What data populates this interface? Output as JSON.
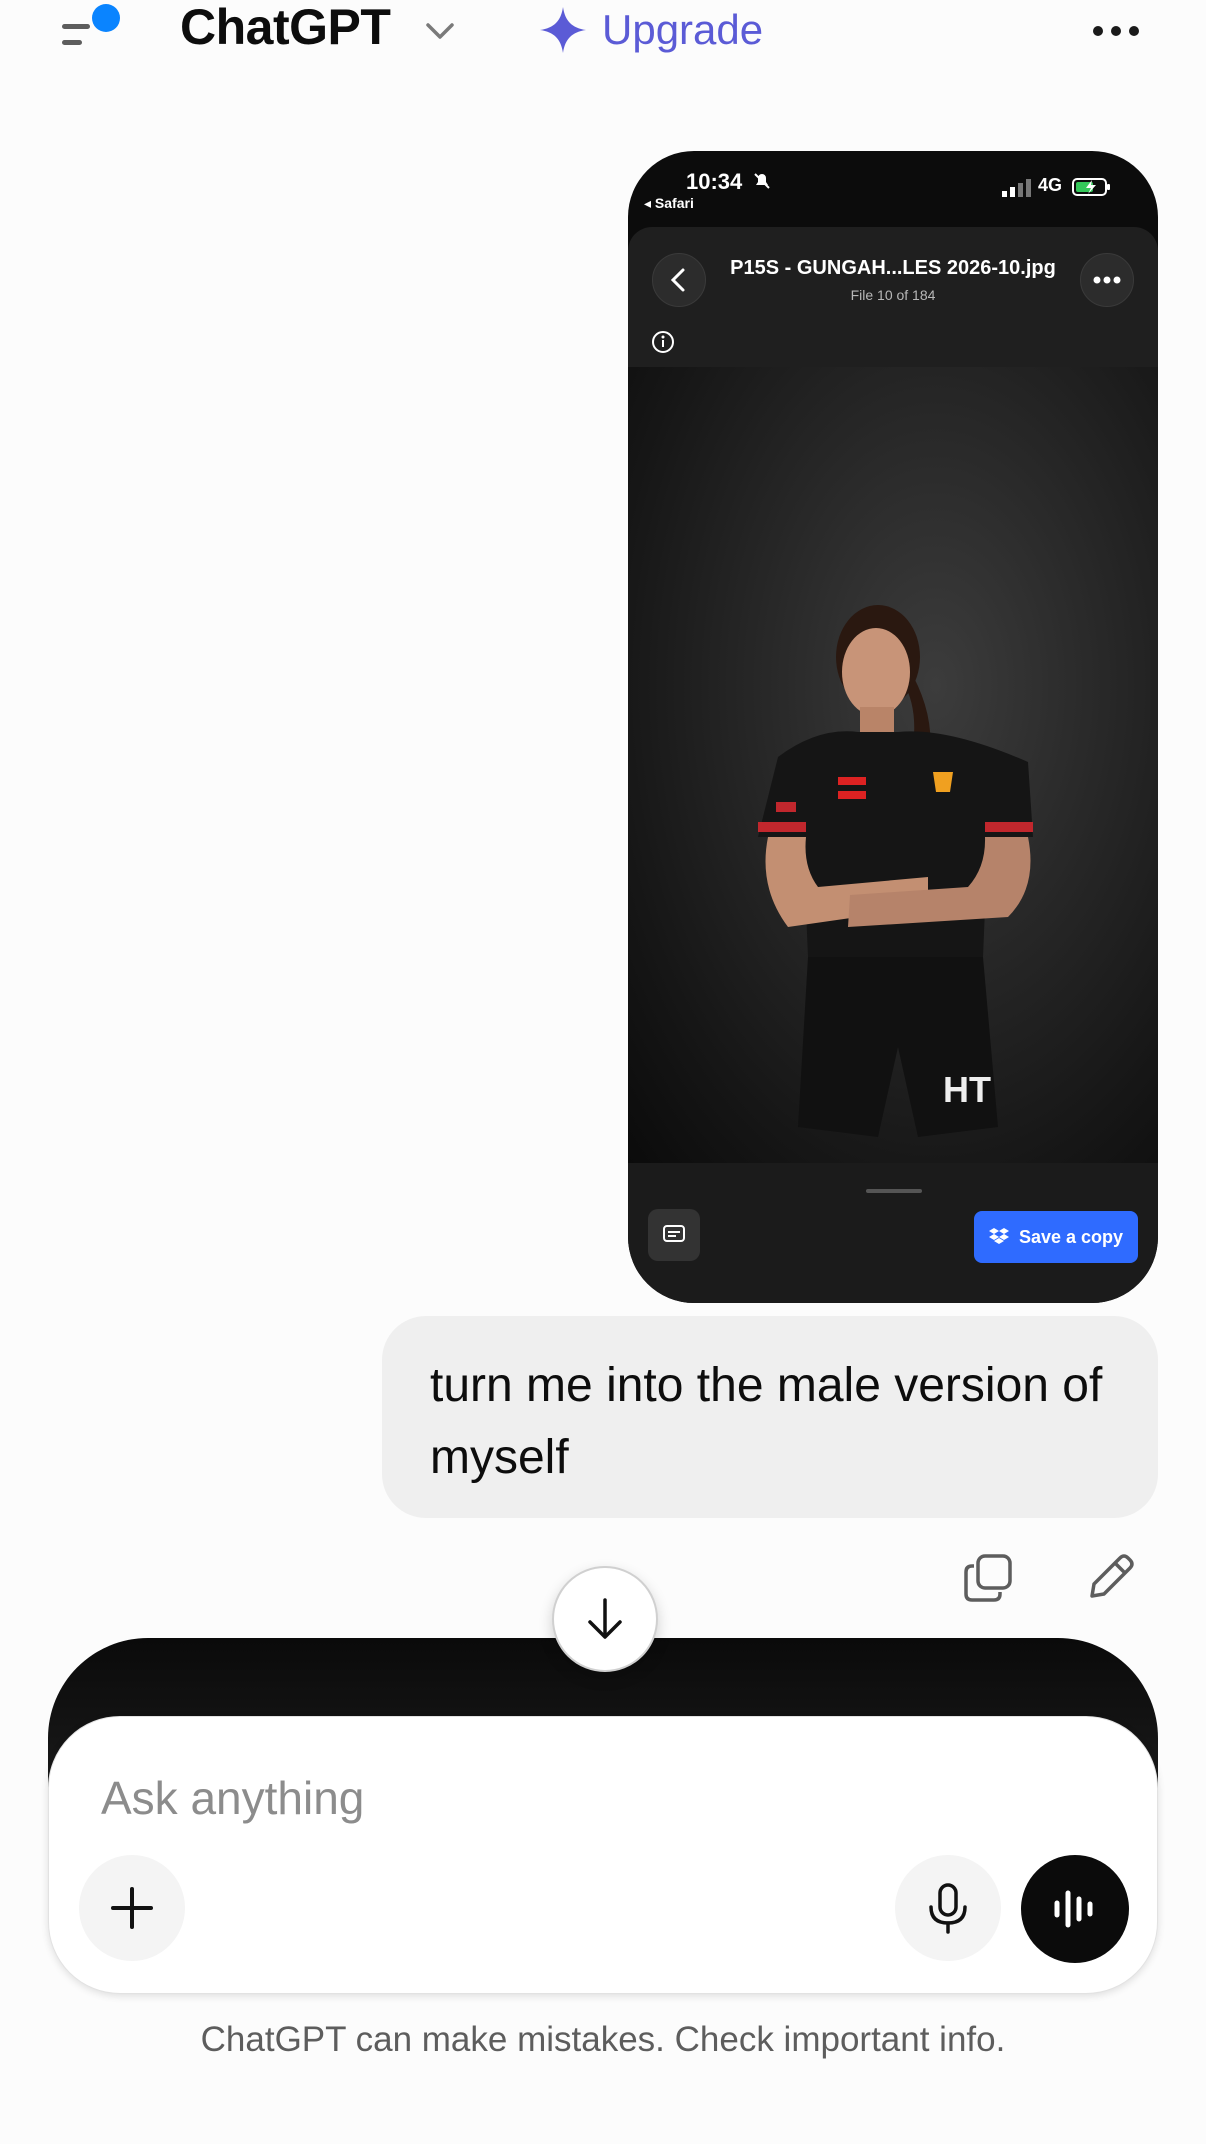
{
  "header": {
    "menu_icon": "sidebar-menu-icon",
    "notification_color": "#0a84ff",
    "title": "ChatGPT",
    "upgrade_label": "Upgrade",
    "upgrade_color": "#5b5bd6"
  },
  "attachment": {
    "status_time": "10:34",
    "status_back_app": "◂ Safari",
    "status_network": "4G",
    "file_name": "P15S - GUNGAH...LES 2026-10.jpg",
    "file_count": "File 10 of 184",
    "save_label": "Save a copy",
    "save_color": "#2f6bff"
  },
  "message": {
    "text": "turn me into the male version of myself"
  },
  "composer": {
    "placeholder": "Ask anything"
  },
  "footer": {
    "disclaimer": "ChatGPT can make mistakes. Check important info."
  }
}
